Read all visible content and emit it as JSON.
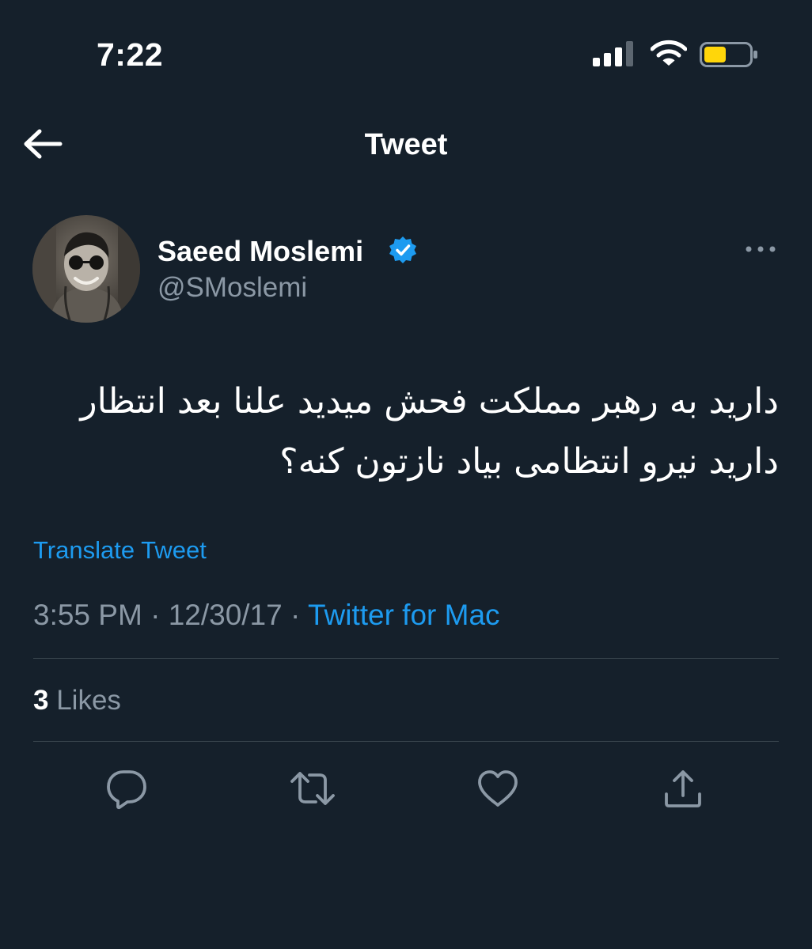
{
  "status_bar": {
    "time": "7:22",
    "icons": [
      "cellular-signal-icon",
      "wifi-icon",
      "battery-icon"
    ],
    "battery_color": "#ffd60a"
  },
  "header": {
    "title": "Tweet",
    "back_icon": "arrow-left-icon"
  },
  "tweet": {
    "author": {
      "name": "Saeed Moslemi",
      "handle": "@SMoslemi",
      "verified": true
    },
    "text": "دارید به رهبر مملکت فحش میدید علنا بعد انتظار دارید نیرو انتظامی بیاد نازتون کنه؟",
    "translate_label": "Translate Tweet",
    "time": "3:55 PM",
    "separator": " · ",
    "date": "12/30/17",
    "source": "Twitter for Mac",
    "likes": {
      "count": "3",
      "label": "Likes"
    }
  },
  "actions": [
    "reply-icon",
    "retweet-icon",
    "like-icon",
    "share-icon"
  ],
  "colors": {
    "background": "#15202b",
    "text": "#ffffff",
    "secondary": "#8b98a5",
    "accent": "#1d9bf0",
    "divider": "#38444d"
  }
}
